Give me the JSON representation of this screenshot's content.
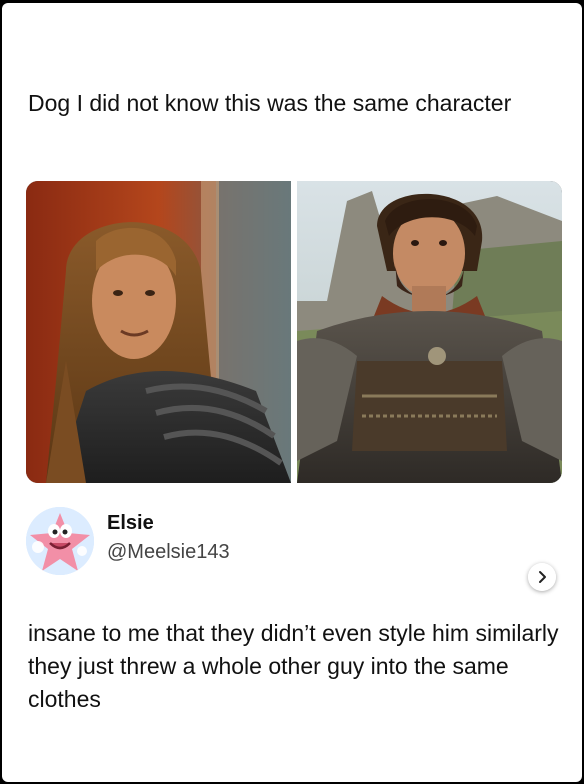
{
  "post": {
    "caption": "Dog I did not know this was the same character"
  },
  "media": {
    "left_image": "actor-with-long-blonde-hair-in-armor",
    "right_image": "bearded-actor-in-leather-armor",
    "next_icon": "chevron-right-icon"
  },
  "quoted_tweet": {
    "display_name": "Elsie",
    "handle": "@Meelsie143",
    "avatar_icon": "cartoon-starfish-avatar",
    "text": "insane to me that they didn’t even style him similarly they just threw a whole other guy into the same clothes"
  }
}
